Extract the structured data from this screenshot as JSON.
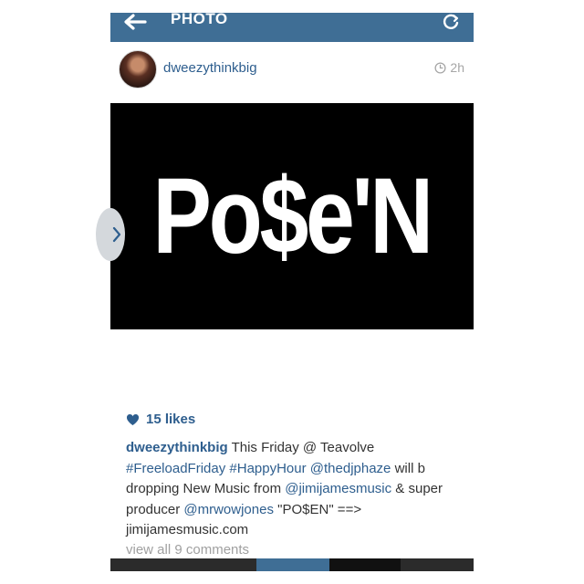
{
  "topbar": {
    "title": "PHOTO",
    "back_icon": "arrow-left-icon",
    "refresh_icon": "refresh-icon"
  },
  "post": {
    "username": "dweezythinkbig",
    "time": "2h",
    "time_icon": "clock-icon",
    "image_text": "Po$e'N",
    "likes": "15 likes",
    "caption": {
      "username": "dweezythinkbig",
      "t1": " This Friday @ Teavolve ",
      "hashtag1": "#FreeloadFriday",
      "t2": " ",
      "hashtag2": "#HappyHour",
      "t3": " ",
      "mention1": "@thedjphaze",
      "t4": " will b dropping New Music from ",
      "mention2": "@jimijamesmusic",
      "t5": " & super producer ",
      "mention3": "@mrwowjones",
      "t6": " \"PO$EN\" ==> jimijamesmusic.com"
    },
    "view_comments": "view all 9 comments"
  },
  "colors": {
    "topbar": "#3f6e95",
    "link": "#2e5e8e",
    "muted": "#a0a0a0"
  }
}
